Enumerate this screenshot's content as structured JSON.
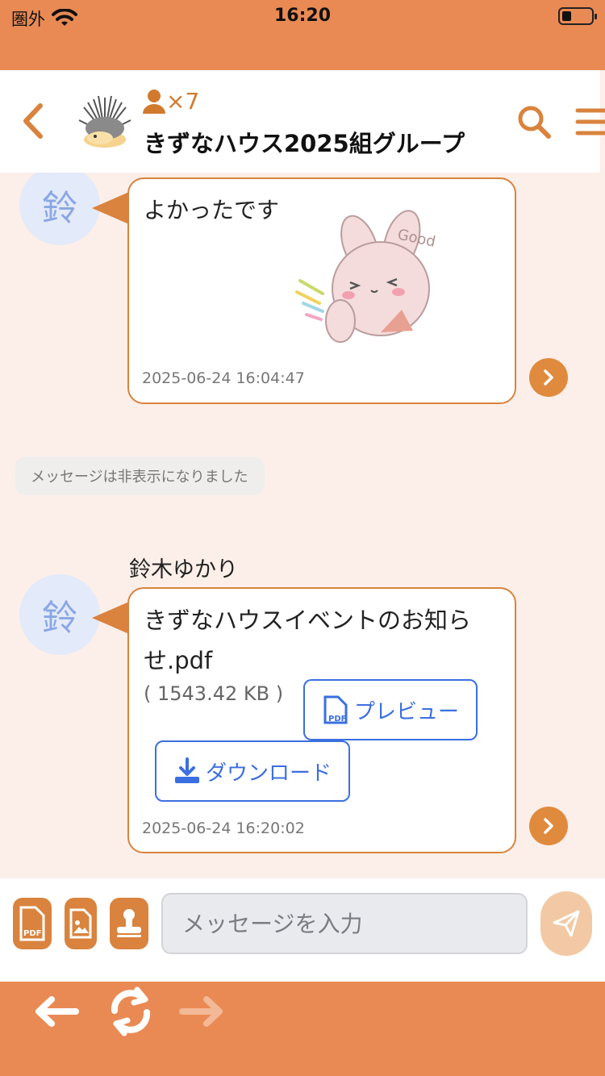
{
  "status_bar": {
    "carrier": "圏外",
    "time": "16:20"
  },
  "header": {
    "member_count": "×7",
    "group_name": "きずなハウス2025組グループ"
  },
  "messages": {
    "first": {
      "avatar_char": "鈴",
      "text": "よかったです",
      "sticker_text": "Good",
      "timestamp": "2025-06-24 16:04:47"
    },
    "hidden_notice": "メッセージは非表示になりました",
    "second": {
      "sender": "鈴木ゆかり",
      "avatar_char": "鈴",
      "file_name": "きずなハウスイベントのお知らせ.pdf",
      "file_size": "( 1543.42 KB )",
      "preview_label": "プレビュー",
      "download_label": "ダウンロード",
      "timestamp": "2025-06-24 16:20:02"
    }
  },
  "input_bar": {
    "placeholder": "メッセージを入力",
    "pdf_label": "PDF"
  },
  "colors": {
    "accent": "#e98a54",
    "bubble_border": "#d9833e",
    "link_blue": "#3b6fe0",
    "avatar_bg": "#e3eaf9",
    "chat_bg": "#fcefe9"
  }
}
